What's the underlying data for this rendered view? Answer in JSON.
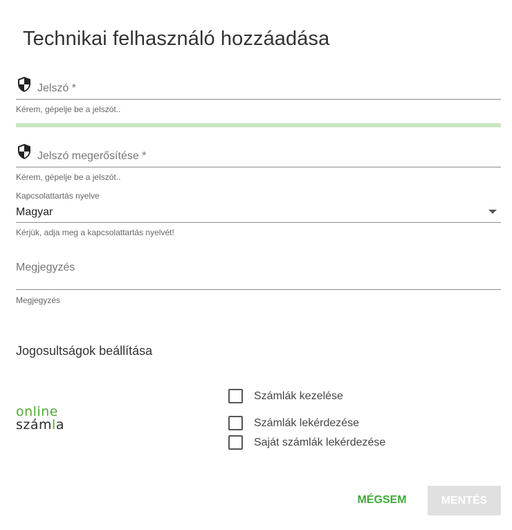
{
  "dialog": {
    "title": "Technikai felhasználó hozzáadása"
  },
  "password": {
    "label": "Jelszó *",
    "hint": "Kérem, gépelje be a jelszót..",
    "strength_color": "#c9e6c3"
  },
  "password_confirm": {
    "label": "Jelszó megerősítése *",
    "hint": "Kérem, gépelje be a jelszót.."
  },
  "language": {
    "label": "Kapcsolattartás nyelve",
    "value": "Magyar",
    "hint": "Kérjük, adja meg a kapcsolattartás nyelvét!"
  },
  "note": {
    "placeholder": "Megjegyzés",
    "hint": "Megjegyzés"
  },
  "permissions": {
    "title": "Jogosultságok beállítása",
    "logo": {
      "line1": "online",
      "line2_a": "szám",
      "line2_b": "l",
      "line2_c": "a"
    },
    "items": [
      {
        "label": "Számlák kezelése",
        "checked": false
      },
      {
        "label": "Számlák lekérdezése",
        "checked": false
      },
      {
        "label": "Saját számlák lekérdezése",
        "checked": false
      }
    ]
  },
  "actions": {
    "cancel": "MÉGSEM",
    "save": "MENTÉS"
  },
  "colors": {
    "accent": "#3cab3a",
    "disabled_button": "#e0e0e0"
  }
}
